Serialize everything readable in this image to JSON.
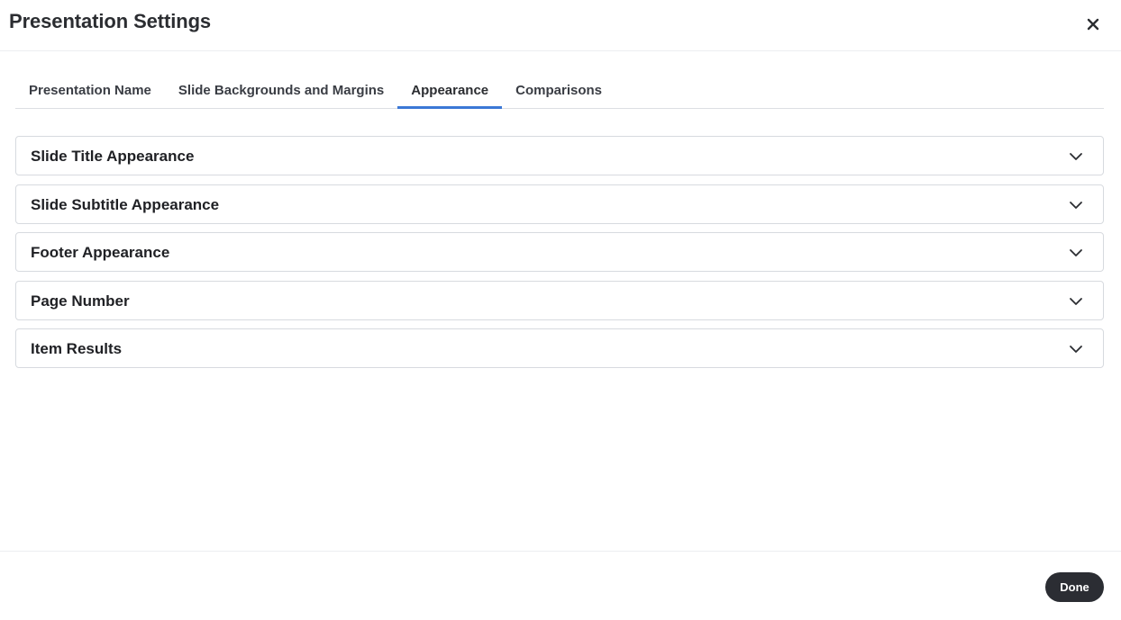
{
  "dialog": {
    "title": "Presentation Settings",
    "close_icon": "close-icon"
  },
  "tabs": [
    {
      "label": "Presentation Name",
      "active": false
    },
    {
      "label": "Slide Backgrounds and Margins",
      "active": false
    },
    {
      "label": "Appearance",
      "active": true
    },
    {
      "label": "Comparisons",
      "active": false
    }
  ],
  "sections": [
    {
      "label": "Slide Title Appearance",
      "icon": "chevron-down-icon"
    },
    {
      "label": "Slide Subtitle Appearance",
      "icon": "chevron-down-icon"
    },
    {
      "label": "Footer Appearance",
      "icon": "chevron-down-icon"
    },
    {
      "label": "Page Number",
      "icon": "chevron-down-icon"
    },
    {
      "label": "Item Results",
      "icon": "chevron-down-icon"
    }
  ],
  "footer": {
    "done_label": "Done"
  },
  "colors": {
    "accent": "#3b78d6",
    "primary_button": "#2b2d33"
  }
}
